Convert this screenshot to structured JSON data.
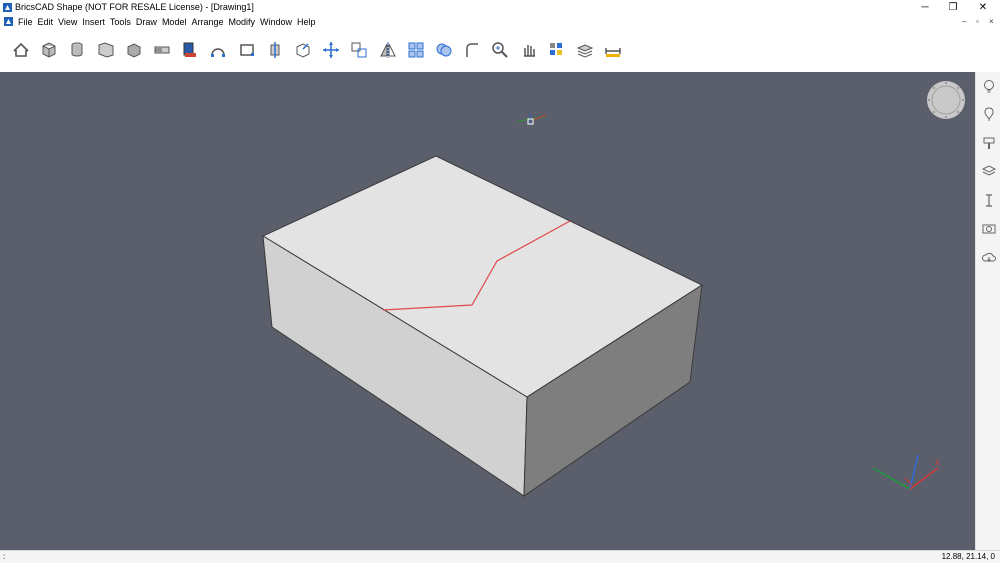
{
  "window": {
    "title": "BricsCAD Shape (NOT FOR RESALE License) - [Drawing1]",
    "controls": {
      "minimize": "─",
      "restore": "❐",
      "close": "✕"
    }
  },
  "menubar": {
    "items": [
      "File",
      "Edit",
      "View",
      "Insert",
      "Tools",
      "Draw",
      "Model",
      "Arrange",
      "Modify",
      "Window",
      "Help"
    ],
    "doc_controls": {
      "minimize": "–",
      "restore": "▫",
      "close": "×"
    }
  },
  "toolbar": {
    "tools": [
      "home-icon",
      "box-icon",
      "cylinder-icon",
      "wall-icon",
      "solid-icon",
      "slab-icon",
      "window-library-icon",
      "arc-icon",
      "rectangle-icon",
      "push-pull-icon",
      "extrude-face-icon",
      "move-icon",
      "copy-icon",
      "mirror-icon",
      "array-icon",
      "union-icon",
      "fillet-icon",
      "zoom-icon",
      "pan-icon",
      "render-icon",
      "layers-toolbar-icon",
      "dimension-icon"
    ]
  },
  "right_panel": {
    "items": [
      "lightbulb-icon",
      "balloon-icon",
      "paint-icon",
      "layers-icon",
      "text-cursor-icon",
      "camera-icon",
      "cloud-icon"
    ]
  },
  "status": {
    "left": ":",
    "coords": "12.88, 21.14, 0"
  },
  "colors": {
    "viewport_bg": "#5b5f6b",
    "box_top": "#e3e3e3",
    "box_left": "#d0d0d0",
    "box_right": "#7d7d7d",
    "edge_line": "#e04a4a",
    "accent": "#1f6fd1"
  }
}
